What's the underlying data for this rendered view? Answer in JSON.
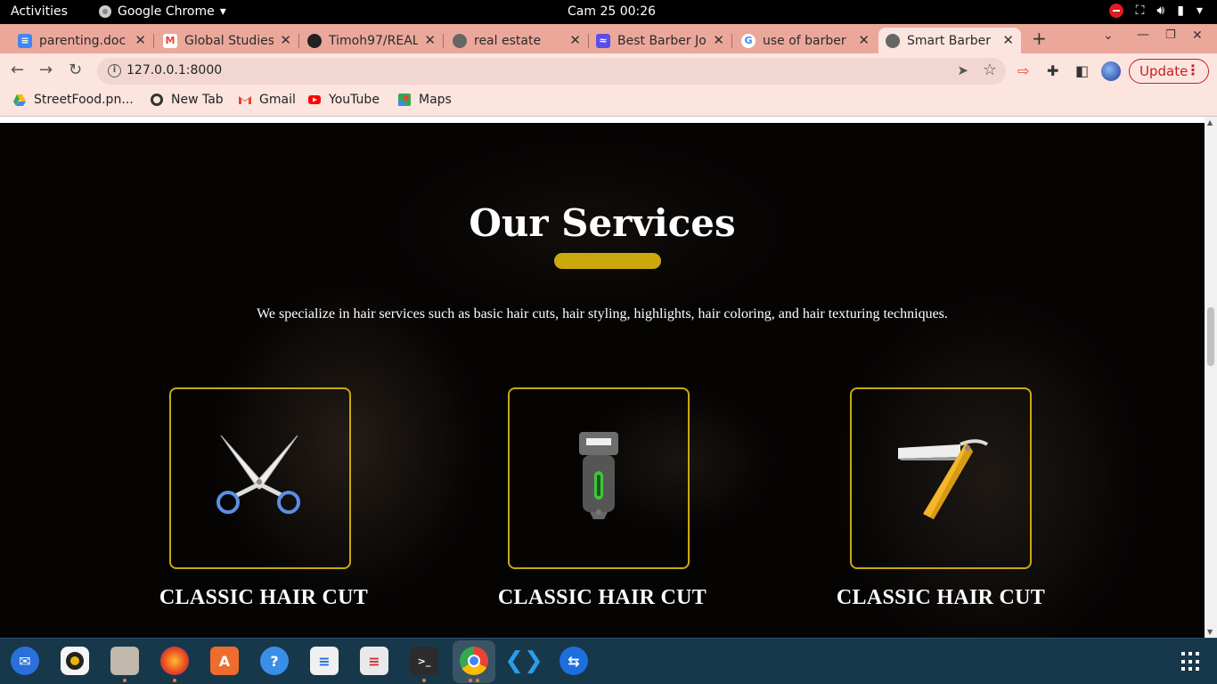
{
  "system": {
    "activities": "Activities",
    "app_name": "Google Chrome",
    "clock": "Cam 25  00:26"
  },
  "tabs": [
    {
      "title": "parenting.doc",
      "icon": "google-docs-icon",
      "color": "#4285f4"
    },
    {
      "title": "Global Studies",
      "icon": "gmail-icon",
      "color": "#ea4335"
    },
    {
      "title": "Timoh97/REAL",
      "icon": "github-icon",
      "color": "#222222"
    },
    {
      "title": "real estate",
      "icon": "globe-icon",
      "color": "#555555"
    },
    {
      "title": "Best Barber Jo",
      "icon": "site-icon",
      "color": "#5b4de8"
    },
    {
      "title": "use of barber",
      "icon": "google-icon",
      "color": "#4285f4"
    },
    {
      "title": "Smart Barber",
      "icon": "globe-icon",
      "color": "#555555",
      "active": true
    }
  ],
  "toolbar": {
    "url": "127.0.0.1:8000",
    "update_label": "Update"
  },
  "bookmarks": [
    {
      "label": "StreetFood.pn...",
      "icon": "google-drive-icon"
    },
    {
      "label": "New Tab",
      "icon": "globe-icon"
    },
    {
      "label": "Gmail",
      "icon": "gmail-icon"
    },
    {
      "label": "YouTube",
      "icon": "youtube-icon"
    },
    {
      "label": "Maps",
      "icon": "maps-icon"
    }
  ],
  "services": {
    "title": "Our Services",
    "description": "We specialize in hair services such as basic hair cuts, hair styling, highlights, hair coloring, and hair texturing techniques.",
    "accent_color": "#c9a90c",
    "cards": [
      {
        "title": "CLASSIC HAIR CUT",
        "icon": "scissors-icon"
      },
      {
        "title": "CLASSIC HAIR CUT",
        "icon": "hair-clipper-icon"
      },
      {
        "title": "CLASSIC HAIR CUT",
        "icon": "straight-razor-icon"
      }
    ]
  },
  "dock": [
    "thunderbird-icon",
    "rhythmbox-icon",
    "files-icon",
    "firefox-icon",
    "software-center-icon",
    "help-icon",
    "libreoffice-writer-icon",
    "document-viewer-icon",
    "terminal-icon",
    "chrome-icon",
    "vscode-icon",
    "teamviewer-icon"
  ]
}
